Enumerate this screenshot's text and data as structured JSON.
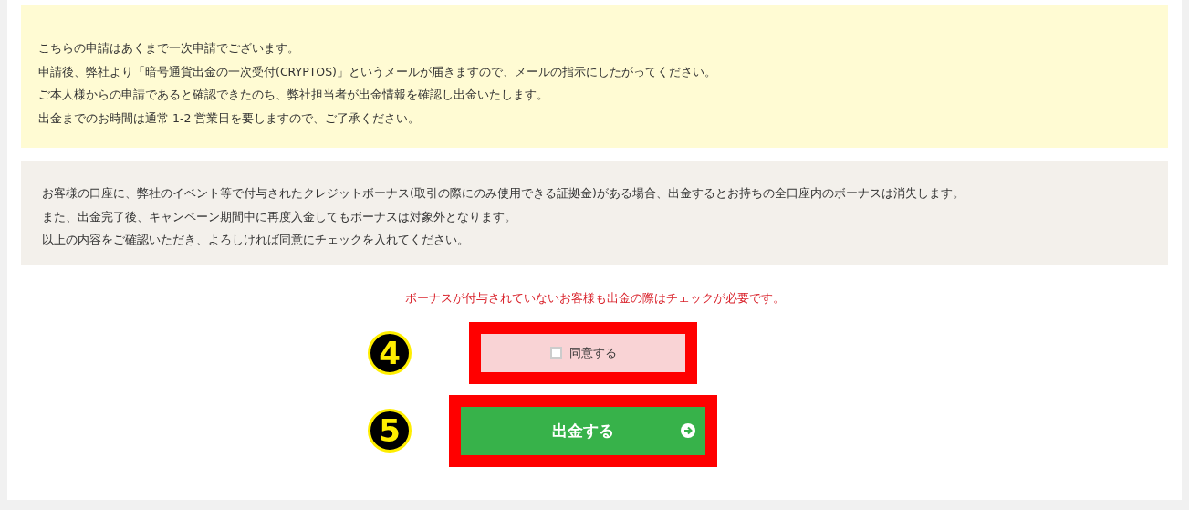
{
  "notice": {
    "lines": [
      "こちらの申請はあくまで一次申請でございます。",
      "申請後、弊社より「暗号通貨出金の一次受付(CRYPTOS)」というメールが届きますので、メールの指示にしたがってください。",
      "ご本人様からの申請であると確認できたのち、弊社担当者が出金情報を確認し出金いたします。",
      "出金までのお時間は通常 1-2 営業日を要しますので、ご了承ください。"
    ]
  },
  "bonus_notice": {
    "lines": [
      "お客様の口座に、弊社のイベント等で付与されたクレジットボーナス(取引の際にのみ使用できる証拠金)がある場合、出金するとお持ちの全口座内のボーナスは消失します。",
      "また、出金完了後、キャンペーン期間中に再度入金してもボーナスは対象外となります。",
      "以上の内容をご確認いただき、よろしければ同意にチェックを入れてください。"
    ]
  },
  "warning": "ボーナスが付与されていないお客様も出金の際はチェックが必要です。",
  "agree": {
    "step": "4",
    "label": "同意する",
    "checked": false
  },
  "submit": {
    "step": "5",
    "label": "出金する"
  }
}
